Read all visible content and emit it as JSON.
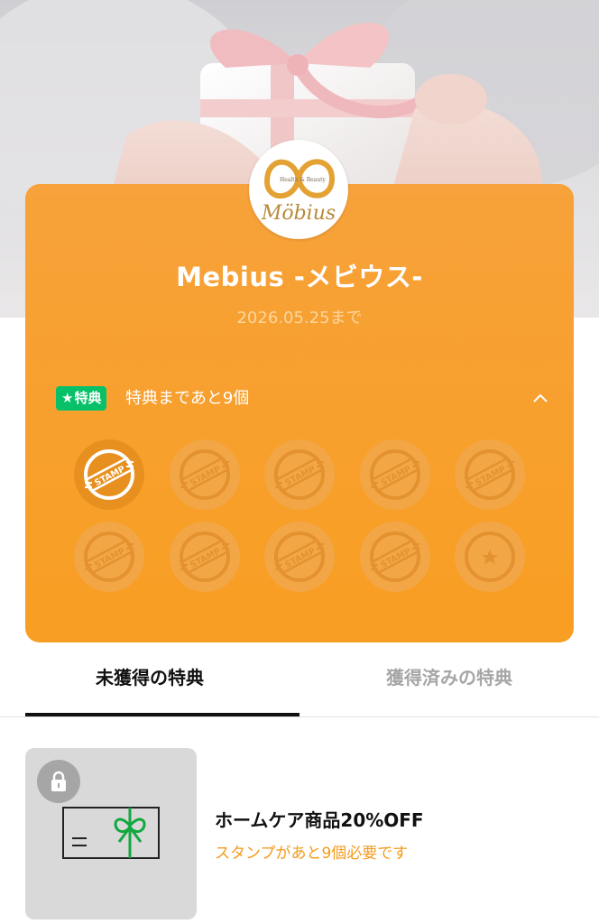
{
  "card": {
    "brand_logo": {
      "name": "Möbius",
      "tagline": "Health & Beauty"
    },
    "title": "Mebius -メビウス-",
    "expiry": "2026.05.25まで",
    "reward_badge": "特典",
    "reward_badge_icon": "star-icon",
    "remaining_text": "特典まであと9個",
    "collapse_icon": "chevron-up-icon",
    "accent_color": "#f89e22",
    "stamps": {
      "label": "STAMP",
      "total": 10,
      "collected": 1,
      "last_is_reward": true
    }
  },
  "tabs": [
    {
      "label": "未獲得の特典",
      "active": true
    },
    {
      "label": "獲得済みの特典",
      "active": false
    }
  ],
  "reward_item": {
    "title": "ホームケア商品20%OFF",
    "note": "スタンプがあと9個必要です",
    "locked": true,
    "lock_icon": "lock-icon",
    "thumb_icon": "gift-card-icon"
  }
}
